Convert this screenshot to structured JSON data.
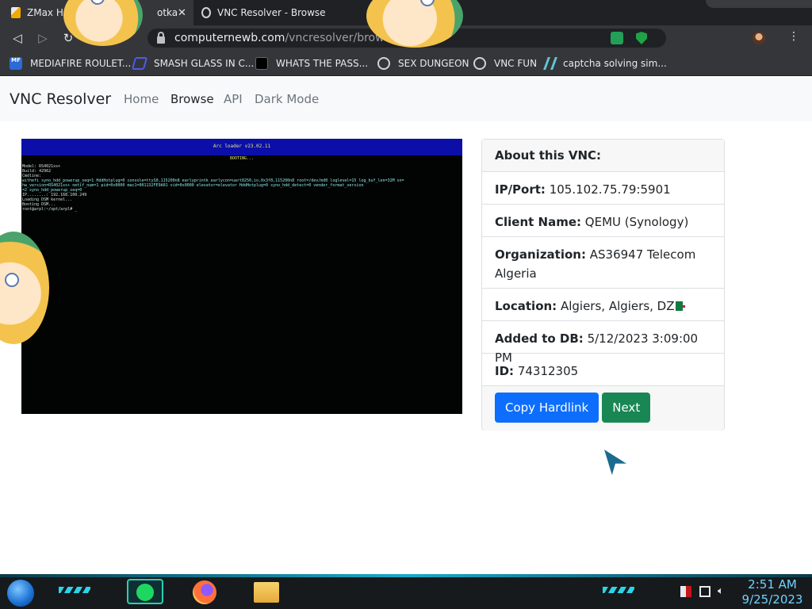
{
  "browser": {
    "tabs": [
      {
        "title": "ZMax Hc",
        "active": true
      },
      {
        "title": "VNC Resolver - Browse",
        "active": false
      }
    ],
    "tab_close_glyph": "✕",
    "tab_fragment": "otka",
    "address": {
      "host": "computernewb.com",
      "path": "/vncresolver/browse/"
    },
    "bookmarks": [
      {
        "label": "MEDIAFIRE ROULET...",
        "icon": "mediafire-icon",
        "icon_text": "MF"
      },
      {
        "label": "SMASH GLASS IN C...",
        "icon": "smash-icon"
      },
      {
        "label": "WHATS THE PASS...",
        "icon": "password-icon"
      },
      {
        "label": "SEX DUNGEON",
        "icon": "vnc-icon"
      },
      {
        "label": "VNC FUN",
        "icon": "vnc-icon"
      },
      {
        "label": "captcha solving sim...",
        "icon": "captcha-icon"
      }
    ]
  },
  "navbar": {
    "brand": "VNC Resolver",
    "links": [
      {
        "label": "Home",
        "active": false
      },
      {
        "label": "Browse",
        "active": true
      },
      {
        "label": "API",
        "active": false
      },
      {
        "label": "Dark Mode",
        "active": false
      }
    ]
  },
  "screenshot": {
    "topbar_text": "Arc loader v23.02.11",
    "sub_text": "BOOTING...",
    "lines": [
      "Model: RS4021xs+",
      "Build: 42962",
      "Cmdline:",
      "withefi syno_hdd_powerup_seq=1 HddHotplug=0 console=ttyS0,115200n8 earlyprintk earlycon=uart8250,io,0x3f8,115200n8 root=/dev/md0 loglevel=15 log_buf_len=32M sn=",
      "hw_version=RS4021xs+ netif_num=1 pid=0x0000 mac1=001132FE9A01 vid=0x0000 elevator=elevator HddHotplug=0 syno_hdd_detect=0 vender_format_version",
      "=2 syno_hdd_powerup_seq=0",
      "IP........: 192.168.100.249",
      "Loading DSM kernel...",
      "Booting DSM...",
      "root@arpl:~/opt/arpl# _"
    ]
  },
  "card": {
    "header": "About this VNC:",
    "ip_label": "IP/Port:",
    "ip_value": "105.102.75.79:5901",
    "client_label": "Client Name:",
    "client_value": "QEMU (Synology)",
    "org_label": "Organization:",
    "org_value": "AS36947 Telecom Algeria",
    "location_label": "Location:",
    "location_value": "Algiers, Algiers, DZ",
    "location_flag": "algeria-flag-icon",
    "added_label": "Added to DB:",
    "added_value": "5/12/2023 3:09:00 PM",
    "id_label": "ID:",
    "id_value": "74312305",
    "copy_label": "Copy Hardlink",
    "next_label": "Next"
  },
  "taskbar": {
    "time": "2:51 AM",
    "date": "9/25/2023"
  },
  "colors": {
    "primary": "#0d6efd",
    "success": "#198754",
    "chrome_dark": "#202124",
    "chrome_toolbar": "#35363a"
  }
}
